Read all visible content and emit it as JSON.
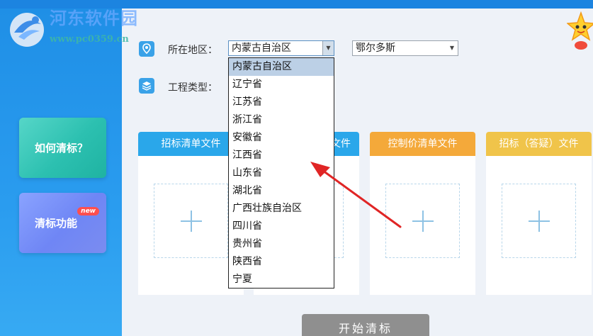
{
  "watermark": {
    "title": "河东软件园",
    "url": "www.pc0359.cn"
  },
  "sidebar": {
    "cards": [
      {
        "label": "如何清标？"
      },
      {
        "label": "清标功能",
        "badge": "new"
      }
    ]
  },
  "form": {
    "region_label": "所在地区：",
    "project_label": "工程类型：",
    "province_selected": "内蒙古自治区",
    "city_selected": "鄂尔多斯"
  },
  "dropdown": {
    "options": [
      "内蒙古自治区",
      "辽宁省",
      "江苏省",
      "浙江省",
      "安徽省",
      "江西省",
      "山东省",
      "湖北省",
      "广西壮族自治区",
      "四川省",
      "贵州省",
      "陕西省",
      "宁夏"
    ]
  },
  "panels": [
    {
      "title": "招标清单文件",
      "color": "#2aa7ea"
    },
    {
      "title": "文件",
      "color": "#2aa7ea"
    },
    {
      "title": "控制价清单文件",
      "color": "#f4a93a"
    },
    {
      "title": "招标（答疑）文件",
      "color": "#f0c44a"
    }
  ],
  "actions": {
    "start_label": "开始清标"
  },
  "colors": {
    "topbar": "#1c84e0",
    "annotation_arrow": "#e02525"
  }
}
